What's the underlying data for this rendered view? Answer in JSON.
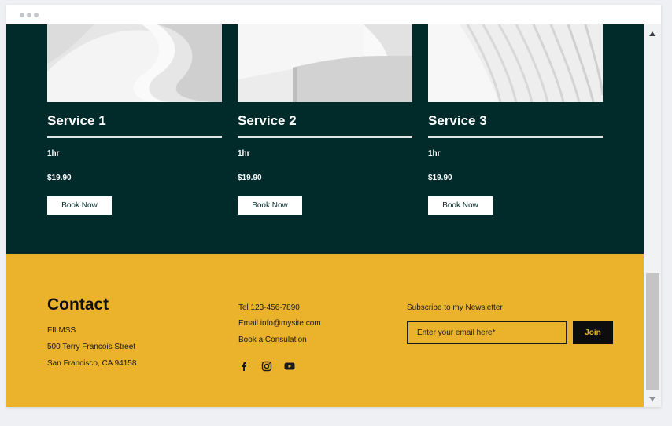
{
  "colors": {
    "services_bg": "#012b2b",
    "footer_bg": "#ebb22b",
    "button_bg": "#ffffff",
    "join_bg": "#0d0d0d",
    "join_text": "#ebb22b"
  },
  "services": [
    {
      "name": "Service 1",
      "duration": "1hr",
      "price": "$19.90",
      "button": "Book Now"
    },
    {
      "name": "Service 2",
      "duration": "1hr",
      "price": "$19.90",
      "button": "Book Now"
    },
    {
      "name": "Service 3",
      "duration": "1hr",
      "price": "$19.90",
      "button": "Book Now"
    }
  ],
  "contact": {
    "title": "Contact",
    "company": "FILMSS",
    "street": "500 Terry Francois Street",
    "city": "San Francisco, CA 94158",
    "tel": "Tel 123-456-7890",
    "email": "Email info@mysite.com",
    "book": "Book a Consulation"
  },
  "social": [
    "facebook-icon",
    "instagram-icon",
    "youtube-icon"
  ],
  "newsletter": {
    "label": "Subscribe to my Newsletter",
    "placeholder": "Enter your email here*",
    "button": "Join"
  }
}
